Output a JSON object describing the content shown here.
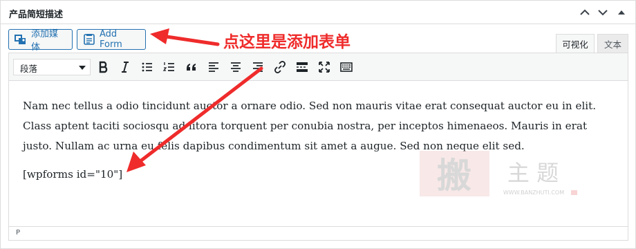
{
  "panel": {
    "title": "产品简短描述"
  },
  "header_icons": {
    "up": "chevron-up-icon",
    "down": "chevron-down-icon",
    "collapse": "triangle-up-icon"
  },
  "buttons": {
    "add_media": "添加媒体",
    "add_form": "Add Form"
  },
  "tabs": {
    "visual": "可视化",
    "text": "文本"
  },
  "toolbar": {
    "format_value": "段落",
    "icons": [
      "bold-icon",
      "italic-icon",
      "bullet-list-icon",
      "numbered-list-icon",
      "blockquote-icon",
      "align-left-icon",
      "align-center-icon",
      "align-right-icon",
      "link-icon",
      "read-more-icon",
      "fullscreen-icon",
      "toolbar-toggle-icon"
    ]
  },
  "content": {
    "paragraph": "Nam nec tellus a odio tincidunt auctor a ornare odio. Sed non mauris vitae erat consequat auctor eu in elit. Class aptent taciti sociosqu ad litora torquent per conubia nostra, per inceptos himenaeos. Mauris in erat justo. Nullam ac urna eu felis dapibus condimentum sit amet a augue. Sed non neque elit sed.",
    "shortcode": "[wpforms id=\"10\"]"
  },
  "statusbar": {
    "path": "P"
  },
  "annotation": {
    "text": "点这里是添加表单",
    "color": "#ef2b2b"
  },
  "watermark": {
    "glyph": "搬",
    "text": "主 题",
    "url": "WWW.BANZHUTI.COM"
  },
  "colors": {
    "accent": "#2271b1",
    "border": "#dcdcde"
  }
}
